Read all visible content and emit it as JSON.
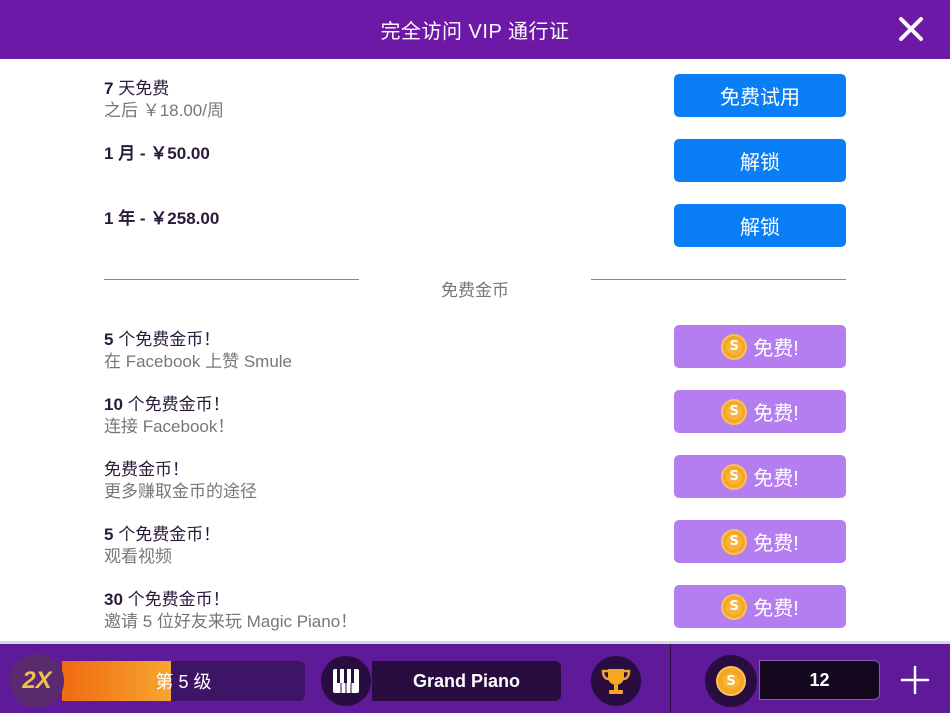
{
  "header": {
    "title": "完全访问 VIP 通行证",
    "close_icon": "close-icon"
  },
  "subscriptions": [
    {
      "title_bold": "7",
      "title_rest": " 天免费",
      "subtitle": "之后 ￥18.00/周",
      "button": "免费试用"
    },
    {
      "title_bold": "1",
      "title_rest": " 月 - ￥50.00",
      "subtitle": "",
      "button": "解锁"
    },
    {
      "title_bold": "1",
      "title_rest": " 年 - ￥258.00",
      "subtitle": "",
      "button": "解锁"
    }
  ],
  "free_coins_section": {
    "label": "免费金币"
  },
  "free_offers": [
    {
      "title_bold": "5",
      "title_rest": " 个免费金币！",
      "subtitle": "在 Facebook 上赞 Smule",
      "button": "免费!"
    },
    {
      "title_bold": "10",
      "title_rest": " 个免费金币！",
      "subtitle": "连接 Facebook！",
      "button": "免费!"
    },
    {
      "title_bold": "",
      "title_rest": "免费金币！",
      "subtitle": "更多赚取金币的途径",
      "button": "免费!"
    },
    {
      "title_bold": "5",
      "title_rest": " 个免费金币！",
      "subtitle": "观看视频",
      "button": "免费!"
    },
    {
      "title_bold": "30",
      "title_rest": " 个免费金币！",
      "subtitle": "邀请 5 位好友来玩 Magic Piano！",
      "button": "免费!"
    }
  ],
  "bottom_bar": {
    "multiplier": "2X",
    "level_label": "第 5 级",
    "level_progress": 0.45,
    "instrument": "Grand Piano",
    "coin_balance": "12",
    "icons": [
      "piano-keys-icon",
      "trophy-icon",
      "coin-icon",
      "plus-icon"
    ]
  },
  "colors": {
    "header_bg": "#6e18a8",
    "primary_button": "#0a7ff5",
    "free_button": "#b57ef0",
    "bottom_bar_bg": "#5e1a98",
    "level_fill": "#f6a630"
  }
}
